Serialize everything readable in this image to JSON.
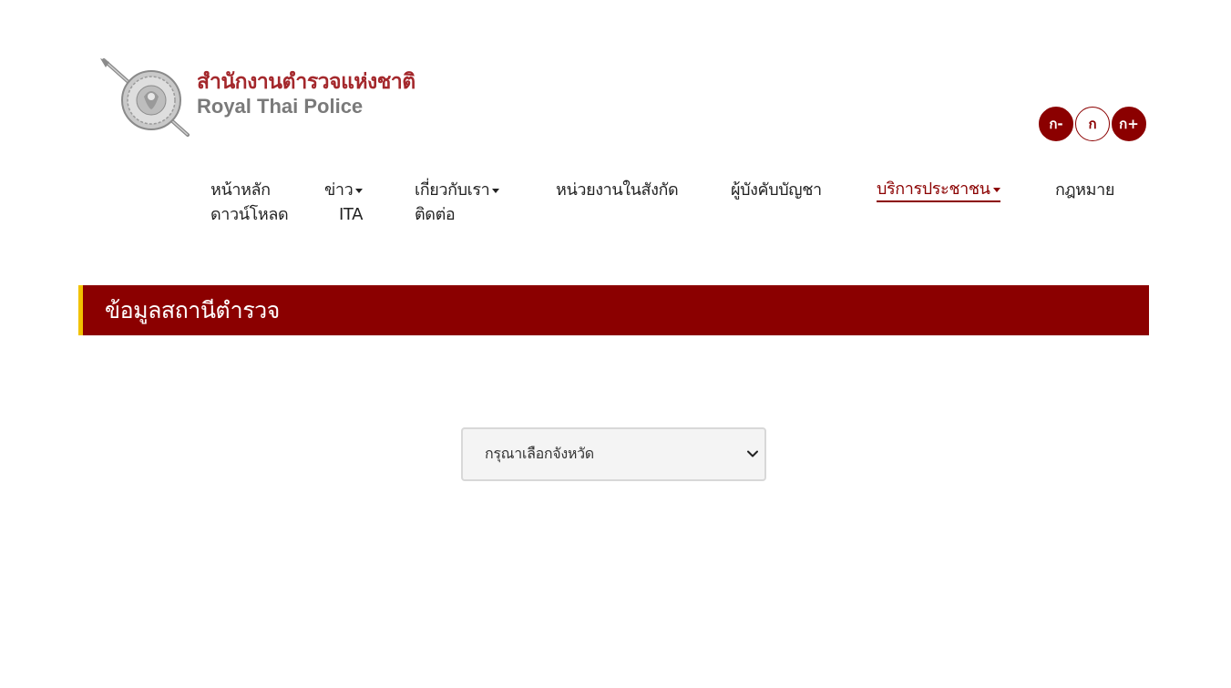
{
  "header": {
    "logo_thai": "สำนักงานตำรวจแห่งชาติ",
    "logo_en": "Royal Thai Police",
    "font_size_buttons": {
      "decrease": "ก-",
      "normal": "ก",
      "increase": "ก+"
    }
  },
  "nav": {
    "home": "หน้าหลัก",
    "news": "ข่าว",
    "about": "เกี่ยวกับเรา",
    "units": "หน่วยงานในสังกัด",
    "commanders": "ผู้บังคับบัญชา",
    "services": "บริการประชาชน",
    "law": "กฎหมาย",
    "download": "ดาวน์โหลด",
    "ita": "ITA",
    "contact": "ติดต่อ",
    "active_item": "services"
  },
  "banner": {
    "title": "ข้อมูลสถานีตำรวจ"
  },
  "province_select": {
    "selected": "กรุณาเลือกจังหวัด"
  },
  "colors": {
    "brand": "#8b0000",
    "accent_bar": "#f2c200",
    "logo_text": "#a4282c",
    "logo_sub": "#7a7a7a"
  }
}
